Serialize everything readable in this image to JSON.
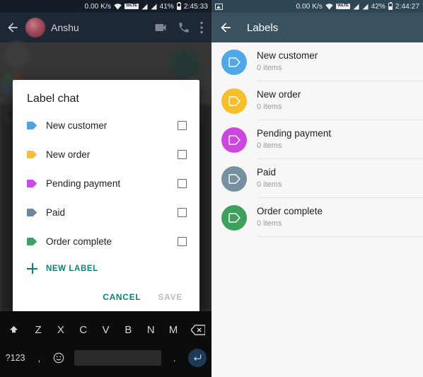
{
  "left": {
    "status_bar": {
      "network_speed": "0.00 K/s",
      "volte_badge": "VoLTE",
      "battery_percent": "41%",
      "clock": "2:45:33"
    },
    "app_bar": {
      "contact_name": "Anshu"
    },
    "dialog": {
      "title": "Label chat",
      "rows": [
        {
          "label": "New customer",
          "color": "#4FA3E3",
          "checked": false
        },
        {
          "label": "New order",
          "color": "#F5BE34",
          "checked": false
        },
        {
          "label": "Pending payment",
          "color": "#CB49E6",
          "checked": false
        },
        {
          "label": "Paid",
          "color": "#6D87A1",
          "checked": false
        },
        {
          "label": "Order complete",
          "color": "#3FA066",
          "checked": false
        }
      ],
      "new_label": "NEW LABEL",
      "cancel": "CANCEL",
      "save": "SAVE"
    },
    "keyboard": {
      "row_letters": [
        "Z",
        "X",
        "C",
        "V",
        "B",
        "N",
        "M"
      ],
      "numeric_key": "?123",
      "comma_key": ",",
      "period_key": ".",
      "space_key": ""
    }
  },
  "right": {
    "status_bar": {
      "network_speed": "0.00 K/s",
      "volte_badge": "VoLTE",
      "battery_percent": "42%",
      "clock": "2:44:27"
    },
    "app_bar": {
      "title": "Labels"
    },
    "labels": [
      {
        "name": "New customer",
        "count": "0 items",
        "color": "#4FA8E8"
      },
      {
        "name": "New order",
        "count": "0 items",
        "color": "#F5BE2B"
      },
      {
        "name": "Pending payment",
        "count": "0 items",
        "color": "#CC47E0"
      },
      {
        "name": "Paid",
        "count": "0 items",
        "color": "#76909F"
      },
      {
        "name": "Order complete",
        "count": "0 items",
        "color": "#3FA05E"
      }
    ]
  }
}
